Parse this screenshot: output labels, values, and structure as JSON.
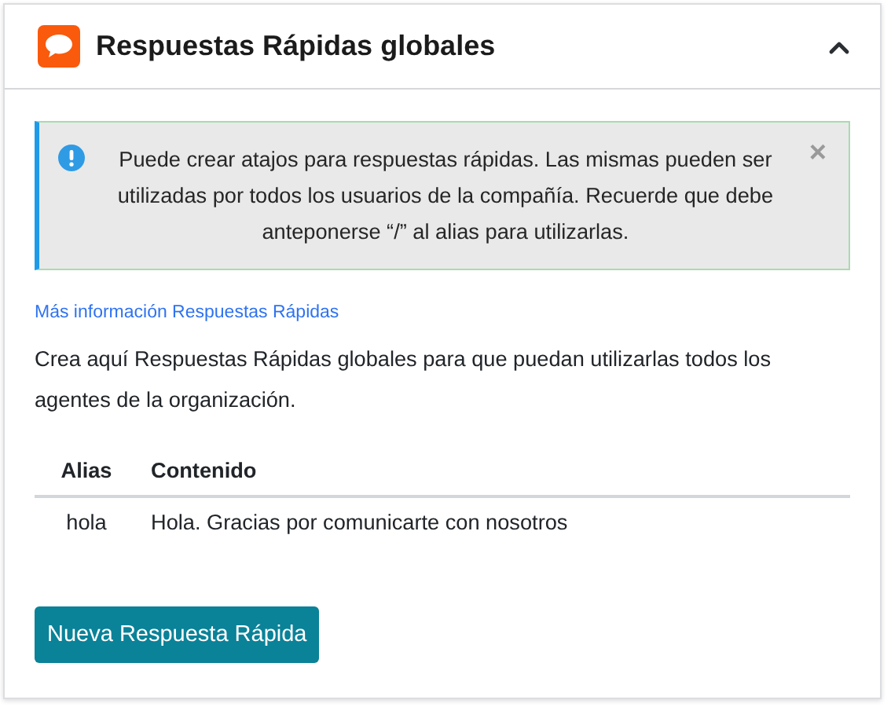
{
  "panel": {
    "title": "Respuestas Rápidas globales",
    "expanded": true
  },
  "alert": {
    "message": "Puede crear atajos para respuestas rápidas. Las mismas pueden ser utilizadas por todos los usuarios de la compañía. Recuerde que debe anteponerse “/” al alias para utilizarlas.",
    "close": "×"
  },
  "help_link": "Más información Respuestas Rápidas",
  "description": "Crea aquí Respuestas Rápidas globales para que puedan utilizarlas todos los agentes de la organización.",
  "table": {
    "columns": [
      "Alias",
      "Contenido"
    ],
    "rows": [
      [
        "hola",
        "Hola. Gracias por comunicarte con nosotros"
      ]
    ]
  },
  "button": "Nueva Respuesta Rápida"
}
